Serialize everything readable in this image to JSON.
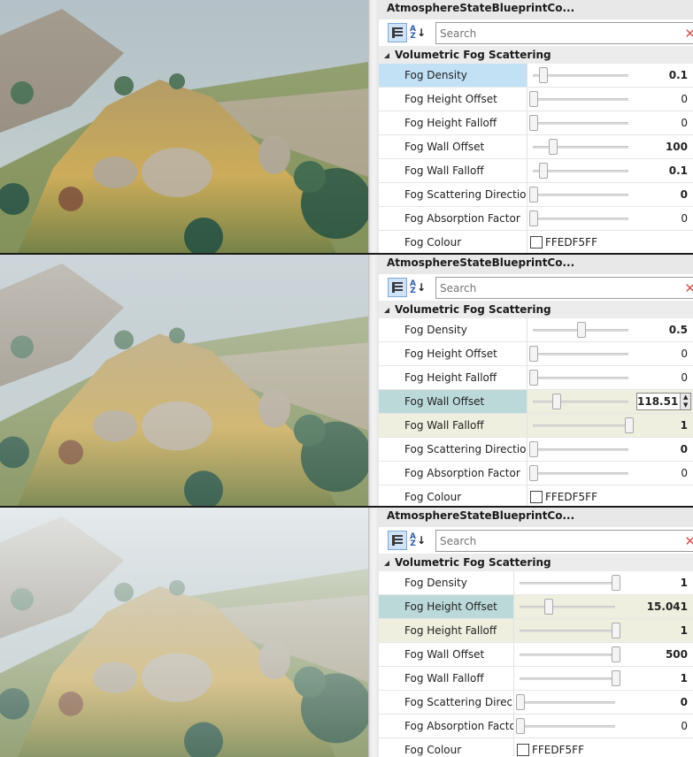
{
  "panels": [
    {
      "title": "AtmosphereStateBlueprintCo...",
      "search_placeholder": "Search",
      "category": "Volumetric Fog Scattering",
      "properties": [
        {
          "name": "Fog Density",
          "value": "0.1",
          "bold": true,
          "slider": 0.1,
          "state": "selected"
        },
        {
          "name": "Fog Height Offset",
          "value": "0",
          "bold": false,
          "slider": 0,
          "state": ""
        },
        {
          "name": "Fog Height Falloff",
          "value": "0",
          "bold": false,
          "slider": 0,
          "state": ""
        },
        {
          "name": "Fog Wall Offset",
          "value": "100",
          "bold": true,
          "slider": 0.2,
          "state": ""
        },
        {
          "name": "Fog Wall Falloff",
          "value": "0.1",
          "bold": true,
          "slider": 0.1,
          "state": ""
        },
        {
          "name": "Fog Scattering Direction",
          "value": "0",
          "bold": true,
          "slider": 0,
          "state": ""
        },
        {
          "name": "Fog Absorption Factor",
          "value": "0",
          "bold": false,
          "slider": 0,
          "state": ""
        }
      ],
      "colour": {
        "name": "Fog Colour",
        "value": "FFEDF5FF"
      }
    },
    {
      "title": "AtmosphereStateBlueprintCo...",
      "search_placeholder": "Search",
      "category": "Volumetric Fog Scattering",
      "properties": [
        {
          "name": "Fog Density",
          "value": "0.5",
          "bold": true,
          "slider": 0.5,
          "state": ""
        },
        {
          "name": "Fog Height Offset",
          "value": "0",
          "bold": false,
          "slider": 0,
          "state": ""
        },
        {
          "name": "Fog Height Falloff",
          "value": "0",
          "bold": false,
          "slider": 0,
          "state": ""
        },
        {
          "name": "Fog Wall Offset",
          "value": "118.51",
          "bold": true,
          "slider": 0.24,
          "state": "active",
          "editing": true
        },
        {
          "name": "Fog Wall Falloff",
          "value": "1",
          "bold": true,
          "slider": 1,
          "state": "hl"
        },
        {
          "name": "Fog Scattering Direction",
          "value": "0",
          "bold": true,
          "slider": 0,
          "state": ""
        },
        {
          "name": "Fog Absorption Factor",
          "value": "0",
          "bold": false,
          "slider": 0,
          "state": ""
        }
      ],
      "colour": {
        "name": "Fog Colour",
        "value": "FFEDF5FF"
      }
    },
    {
      "title": "AtmosphereStateBlueprintCo...",
      "search_placeholder": "Search",
      "category": "Volumetric Fog Scattering",
      "properties": [
        {
          "name": "Fog Density",
          "value": "1",
          "bold": true,
          "slider": 1,
          "state": ""
        },
        {
          "name": "Fog Height Offset",
          "value": "15.041",
          "bold": true,
          "slider": 0.3,
          "state": "active"
        },
        {
          "name": "Fog Height Falloff",
          "value": "1",
          "bold": true,
          "slider": 1,
          "state": "hl"
        },
        {
          "name": "Fog Wall Offset",
          "value": "500",
          "bold": true,
          "slider": 1,
          "state": ""
        },
        {
          "name": "Fog Wall Falloff",
          "value": "1",
          "bold": true,
          "slider": 1,
          "state": ""
        },
        {
          "name": "Fog Scattering Direc...",
          "value": "0",
          "bold": true,
          "slider": 0,
          "state": ""
        },
        {
          "name": "Fog Absorption Factor",
          "value": "0",
          "bold": false,
          "slider": 0,
          "state": ""
        }
      ],
      "colour": {
        "name": "Fog Colour",
        "value": "FFEDF5FF"
      }
    }
  ],
  "colors": {
    "selected_row": "#c3e1f5",
    "active_row": "#bcd9d9",
    "edited_value_bg": "#efefdf",
    "clear_icon": "#d9534f"
  },
  "fog_levels": [
    0.25,
    0.55,
    0.85
  ]
}
